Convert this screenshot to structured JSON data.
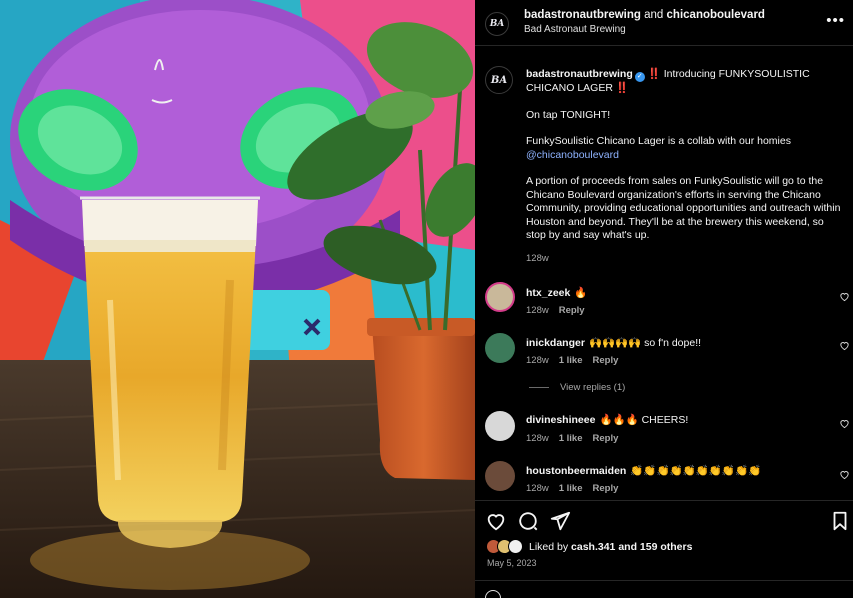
{
  "post": {
    "header": {
      "owner": "badastronautbrewing",
      "and_text": "and",
      "collaborator": "chicanoboulevard",
      "subtitle": "Bad Astronaut Brewing",
      "avatar_text": "BA",
      "more_icon": "more-horizontal-icon"
    },
    "caption": {
      "username": "badastronautbrewing",
      "verified_mark": "✓",
      "bang": "‼️",
      "title": "Introducing FUNKYSOULISTIC CHICANO LAGER",
      "line1": "On tap TONIGHT!",
      "line2_prefix": "FunkySoulistic Chicano Lager is a collab with our homies",
      "line2_mention": "@chicanoboulevard",
      "line3": "A portion of proceeds from sales on FunkySoulistic will go to the Chicano Boulevard organization's efforts in serving the Chicano Community, providing educational opportunities and outreach within Houston and beyond. They'll be at the brewery this weekend, so stop by and say what's up.",
      "age": "128w"
    },
    "comments": [
      {
        "username": "htx_zeek",
        "text": "🔥",
        "age": "128w",
        "likes": "",
        "reply": "Reply",
        "avatar_color": "#c9b89a"
      },
      {
        "username": "inickdanger",
        "text": "🙌🙌🙌🙌 so f'n dope!!",
        "age": "128w",
        "likes": "1 like",
        "reply": "Reply",
        "avatar_color": "#3c7a5a"
      },
      {
        "username": "divineshineee",
        "text": "🔥🔥🔥 CHEERS!",
        "age": "128w",
        "likes": "1 like",
        "reply": "Reply",
        "avatar_color": "#d8d8d8"
      },
      {
        "username": "houstonbeermaiden",
        "text": "👏👏👏👏👏👏👏👏👏👏",
        "age": "128w",
        "likes": "1 like",
        "reply": "Reply",
        "avatar_color": "#6b4b3a"
      }
    ],
    "view_replies": "View replies (1)",
    "actions": {
      "like_icon": "heart-icon",
      "comment_icon": "comment-icon",
      "share_icon": "send-icon",
      "save_icon": "bookmark-icon"
    },
    "likes": {
      "prefix": "Liked by",
      "user": "cash.341",
      "suffix": "and 159 others"
    },
    "date": "May 5, 2023"
  },
  "colors": {
    "panel_bg": "#000000",
    "mention": "#8fb3ff",
    "verified": "#3897f0",
    "muted": "#a8a8a8"
  }
}
